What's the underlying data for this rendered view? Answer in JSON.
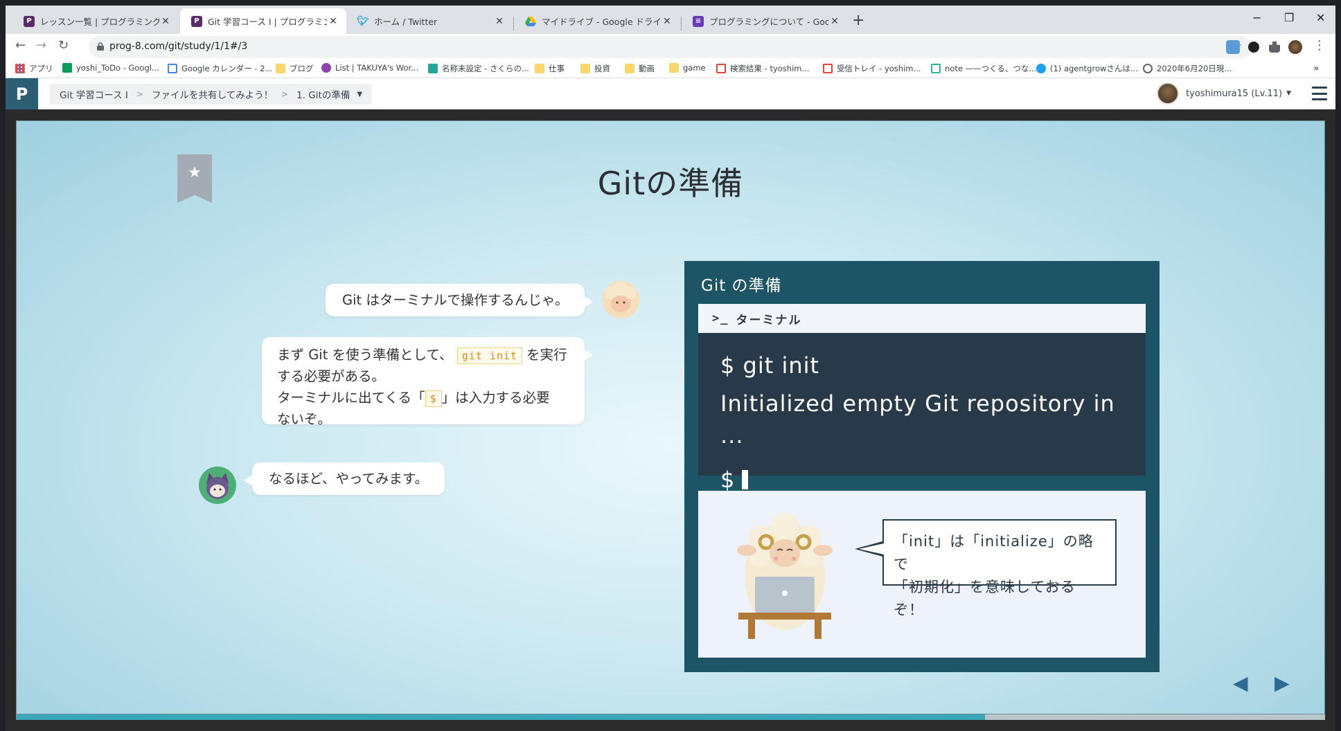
{
  "browser": {
    "tabs": [
      {
        "title": "レッスン一覧 | プログラミングの入門な",
        "active": false,
        "fav_color": "#5a2b6a"
      },
      {
        "title": "Git 学習コース I | プログラミングの入門",
        "active": true,
        "fav_color": "#5a2b6a"
      },
      {
        "title": "ホーム / Twitter",
        "active": false,
        "fav_color": "#1da1f2"
      },
      {
        "title": "マイドライブ - Google ドライブ",
        "active": false,
        "fav_color": "#34a853"
      },
      {
        "title": "プログラミングについて - Google フォー",
        "active": false,
        "fav_color": "#673ab7"
      }
    ],
    "new_tab": "+",
    "window_controls": {
      "minimize": "−",
      "restore": "❐",
      "close": "✕"
    },
    "nav": {
      "back": "←",
      "forward": "→",
      "reload": "↻"
    },
    "url": "prog-8.com/git/study/1/1#/3",
    "star": "☆",
    "menu": "⋮",
    "bookmarks": [
      {
        "label": "アプリ",
        "icon": "apps-icon"
      },
      {
        "label": "yoshi_ToDo - Googl...",
        "icon": "sheets-icon"
      },
      {
        "label": "Google カレンダー - 2...",
        "icon": "calendar-icon"
      },
      {
        "label": "ブログ",
        "icon": "folder-icon"
      },
      {
        "label": "List | TAKUYA's Wor...",
        "icon": "list-icon"
      },
      {
        "label": "名称未設定 - さくらの...",
        "icon": "sakura-icon"
      },
      {
        "label": "仕事",
        "icon": "folder-icon"
      },
      {
        "label": "投資",
        "icon": "folder-icon"
      },
      {
        "label": "動画",
        "icon": "folder-icon"
      },
      {
        "label": "game",
        "icon": "folder-icon"
      },
      {
        "label": "検索結果 - tyoshim...",
        "icon": "gmail-icon"
      },
      {
        "label": "受信トレイ - yoshim...",
        "icon": "gmail-icon"
      },
      {
        "label": "note ——つくる、つな...",
        "icon": "note-icon"
      },
      {
        "label": "(1) agentgrowさんは...",
        "icon": "twitter-icon"
      },
      {
        "label": "2020年6月20日現...",
        "icon": "globe-icon"
      }
    ],
    "bookmarks_more": "»"
  },
  "site": {
    "breadcrumb": [
      "Git 学習コース I",
      "ファイルを共有してみよう！",
      "1. Gitの準備"
    ],
    "user": "tyoshimura15 (Lv.11)"
  },
  "slide": {
    "title": "Gitの準備",
    "messages": [
      {
        "speaker": "sheep",
        "text": "Git はターミナルで操作するんじゃ。"
      },
      {
        "speaker": "sheep",
        "lines": [
          "まず Git を使う準備として、",
          "git init",
          "を実行",
          "する必要がある。",
          "ターミナルに出てくる「",
          "$",
          "」は入力する必要",
          "ないぞ。"
        ]
      },
      {
        "speaker": "user",
        "text": "なるほど、やってみます。"
      }
    ],
    "panel": {
      "title": "Git の準備",
      "terminal_label": "ターミナル",
      "terminal_prompt_icon": ">_",
      "lines": [
        "$ git init",
        "Initialized empty Git repository in ···",
        "$"
      ],
      "info_lines": [
        "「init」は「initialize」の略で",
        "「初期化」を意味しておるぞ！"
      ]
    },
    "prev": "◀",
    "next": "▶",
    "progress": 0.74
  }
}
